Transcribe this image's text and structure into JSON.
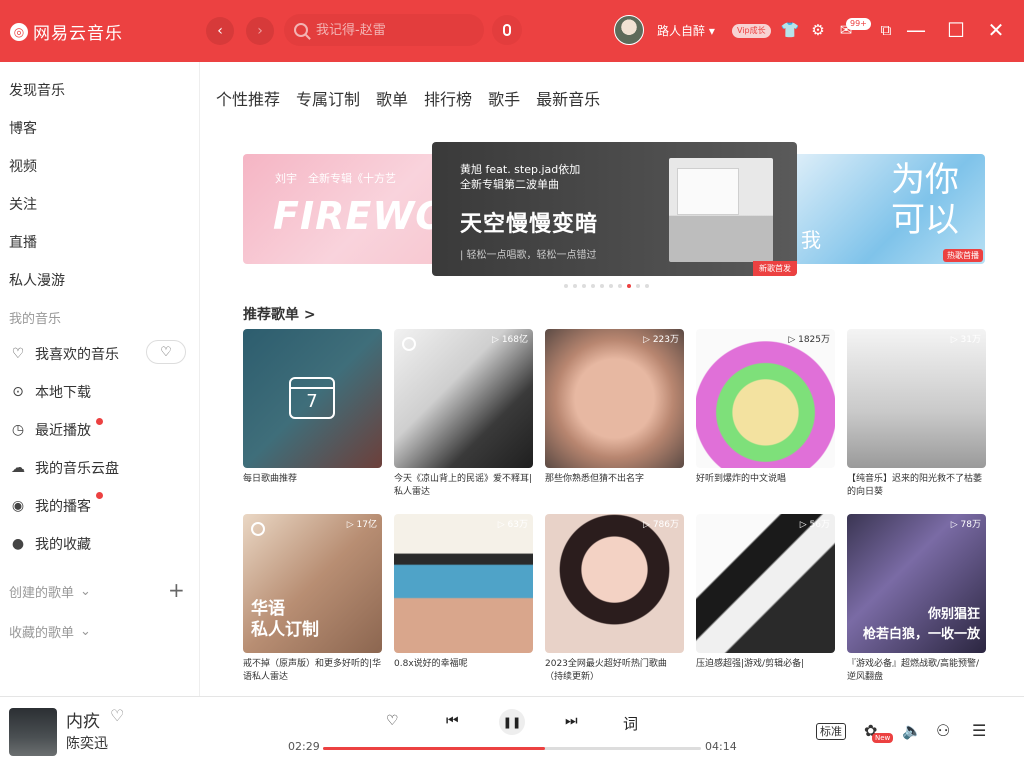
{
  "app": {
    "name": "网易云音乐",
    "accent": "#ec4141"
  },
  "header": {
    "search_placeholder": "我记得-赵雷",
    "username": "路人自醉",
    "vip_label": "Vip成长",
    "mail_badge": "99+"
  },
  "sidebar": {
    "top_items": [
      "发现音乐",
      "博客",
      "视频",
      "关注",
      "直播",
      "私人漫游"
    ],
    "my_music_heading": "我的音乐",
    "my_items": [
      {
        "label": "我喜欢的音乐",
        "icon": "heart-icon"
      },
      {
        "label": "本地下载",
        "icon": "download-icon"
      },
      {
        "label": "最近播放",
        "icon": "clock-icon",
        "dot": true
      },
      {
        "label": "我的音乐云盘",
        "icon": "cloud-icon"
      },
      {
        "label": "我的播客",
        "icon": "podcast-icon",
        "dot": true
      },
      {
        "label": "我的收藏",
        "icon": "user-icon"
      }
    ],
    "created_heading": "创建的歌单",
    "collected_heading": "收藏的歌单"
  },
  "tabs": [
    "个性推荐",
    "专属订制",
    "歌单",
    "排行榜",
    "歌手",
    "最新音乐"
  ],
  "banner": {
    "left_line": "刘宇　全新专辑《十方艺",
    "left_big": "FIREWO",
    "center_line1": "黄旭 feat. step.jad依加",
    "center_line2": "全新专辑第二波单曲",
    "center_title": "天空慢慢变暗",
    "center_sub": "| 轻松一点唱歌，轻松一点错过",
    "center_tag": "新歌首发",
    "right_big": "为你\n可以",
    "right_mini": "我",
    "right_tag": "热歌首播",
    "dots_total": 10,
    "dots_active": 8
  },
  "section_title": "推荐歌单 >",
  "playlists": [
    {
      "caption": "每日歌曲推荐",
      "count": "",
      "calendar_day": "7"
    },
    {
      "caption": "今天《凉山背上的民谣》爱不释耳|私人雷达",
      "count": "▷ 168亿"
    },
    {
      "caption": "那些你熟悉但猜不出名字",
      "count": "▷ 223万"
    },
    {
      "caption": "好听到爆炸的中文说唱",
      "count": "▷ 1825万"
    },
    {
      "caption": "【纯音乐】迟来的阳光救不了枯萎的向日葵",
      "count": "▷ 31万"
    },
    {
      "caption": "戒不掉（原声版）和更多好听的|华语私人雷达",
      "count": "▷ 17亿",
      "overlay": "华语\n私人订制"
    },
    {
      "caption": "0.8x说好的幸福呢",
      "count": "▷ 63万"
    },
    {
      "caption": "2023全网最火超好听热门歌曲（持续更新）",
      "count": "▷ 786万"
    },
    {
      "caption": "压迫感超强|游戏/剪辑必备|",
      "count": "▷ 56万"
    },
    {
      "caption": "『游戏必备』超燃战歌/高能预警/逆风翻盘",
      "count": "▷ 78万",
      "overlay": "你别猖狂\n枪若白狼，一收一放"
    }
  ],
  "player": {
    "song": "内疚",
    "artist": "陈奕迅",
    "current_time": "02:29",
    "total_time": "04:14",
    "progress": 0.587,
    "lyrics_label": "词",
    "quality_label": "标准",
    "new_tag": "New"
  }
}
